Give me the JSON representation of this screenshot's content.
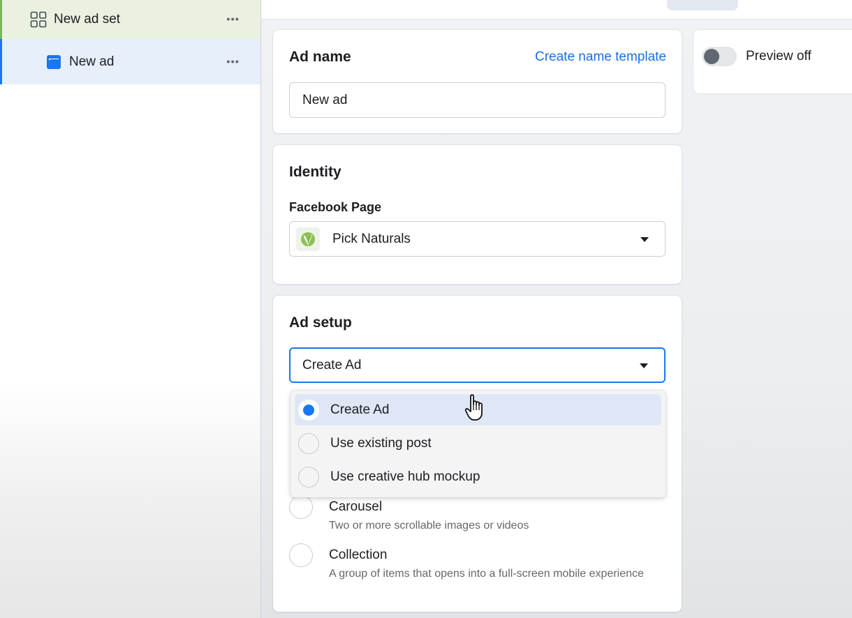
{
  "sidebar": {
    "ad_set": {
      "label": "New ad set",
      "menu": "•••"
    },
    "ad": {
      "label": "New ad",
      "menu": "•••"
    }
  },
  "ad_name": {
    "title": "Ad name",
    "template_link": "Create name template",
    "value": "New ad"
  },
  "identity": {
    "title": "Identity",
    "page_label": "Facebook Page",
    "page_value": "Pick Naturals"
  },
  "ad_setup": {
    "title": "Ad setup",
    "selected": "Create Ad",
    "options": [
      {
        "label": "Create Ad",
        "selected": true
      },
      {
        "label": "Use existing post",
        "selected": false
      },
      {
        "label": "Use creative hub mockup",
        "selected": false
      }
    ],
    "formats": [
      {
        "title": "Carousel",
        "description": "Two or more scrollable images or videos"
      },
      {
        "title": "Collection",
        "description": "A group of items that opens into a full-screen mobile experience"
      }
    ]
  },
  "preview": {
    "label": "Preview off",
    "on": false
  },
  "colors": {
    "accent": "#1877f2",
    "link": "#1b6fe0",
    "adset_bar": "#7ab55c"
  },
  "icons": {
    "ad_set": "grid-icon",
    "ad": "ad-icon",
    "page_logo": "leaf-logo-icon",
    "caret": "caret-down-icon",
    "cursor": "hand-pointer-icon"
  }
}
